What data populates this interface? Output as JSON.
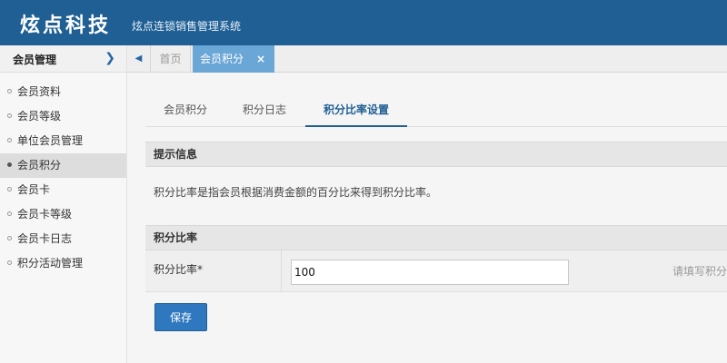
{
  "header": {
    "logo": "炫点科技",
    "subtitle": "炫点连锁销售管理系统"
  },
  "sidebar": {
    "title": "会员管理",
    "items": [
      {
        "label": "会员资料"
      },
      {
        "label": "会员等级"
      },
      {
        "label": "单位会员管理"
      },
      {
        "label": "会员积分",
        "active": true
      },
      {
        "label": "会员卡"
      },
      {
        "label": "会员卡等级"
      },
      {
        "label": "会员卡日志"
      },
      {
        "label": "积分活动管理"
      }
    ]
  },
  "tabs": {
    "home": "首页",
    "active": "会员积分",
    "close_glyph": "×"
  },
  "subtabs": [
    {
      "label": "会员积分"
    },
    {
      "label": "积分日志"
    },
    {
      "label": "积分比率设置",
      "active": true
    }
  ],
  "hint": {
    "title": "提示信息",
    "text": "积分比率是指会员根据消费金额的百分比来得到积分比率。"
  },
  "form": {
    "section_title": "积分比率",
    "label": "积分比率*",
    "value": "100",
    "help": "请填写积分比率"
  },
  "buttons": {
    "save": "保存"
  },
  "colors": {
    "header_bg": "#1f5f94",
    "tab_active_bg": "#6aa6d6",
    "button_bg": "#2f78bf"
  }
}
